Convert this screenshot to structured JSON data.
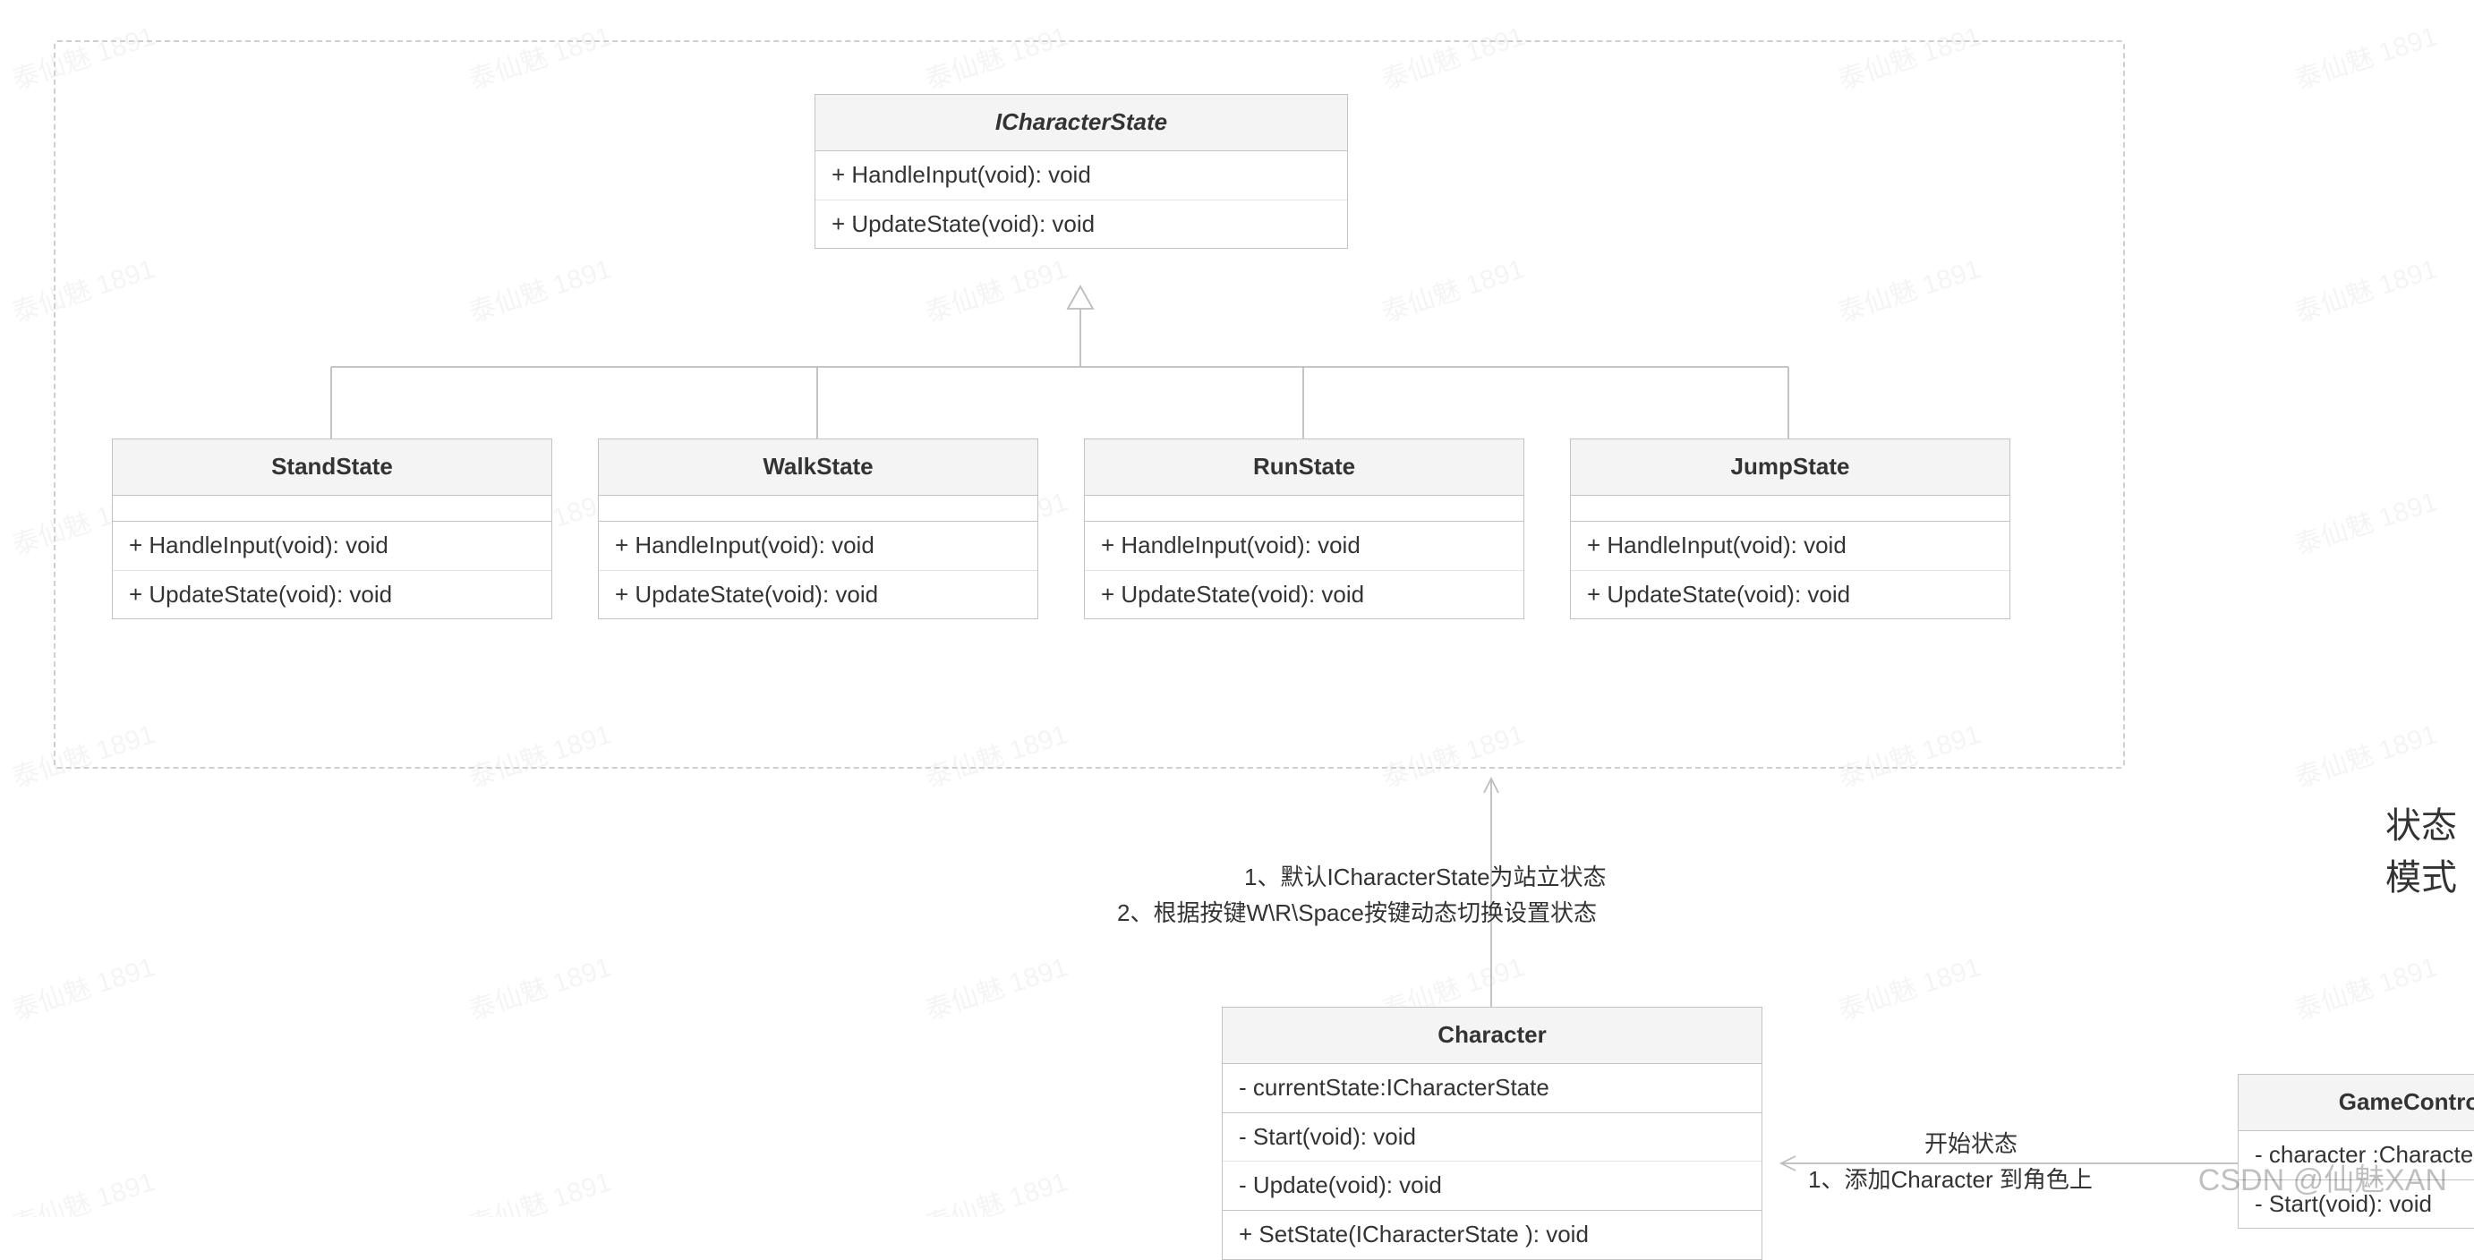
{
  "title_label": "状态模式",
  "watermark_text": "泰仙魅 1891",
  "csdn_text": "CSDN @仙魅XAN",
  "interface": {
    "name": "ICharacterState",
    "methods": [
      "+ HandleInput(void): void",
      "+ UpdateState(void): void"
    ]
  },
  "states": [
    {
      "name": "StandState",
      "methods": [
        "+ HandleInput(void): void",
        "+ UpdateState(void): void"
      ]
    },
    {
      "name": "WalkState",
      "methods": [
        "+ HandleInput(void): void",
        "+ UpdateState(void): void"
      ]
    },
    {
      "name": "RunState",
      "methods": [
        "+ HandleInput(void): void",
        "+ UpdateState(void): void"
      ]
    },
    {
      "name": "JumpState",
      "methods": [
        "+ HandleInput(void): void",
        "+ UpdateState(void): void"
      ]
    }
  ],
  "character": {
    "name": "Character",
    "attrs": [
      "- currentState:ICharacterState"
    ],
    "ops_top": [
      "- Start(void): void",
      "- Update(void): void"
    ],
    "ops_bottom": [
      "+ SetState(ICharacterState ): void"
    ]
  },
  "game_controller": {
    "name": "GameController",
    "attrs": [
      "- character :Character"
    ],
    "ops": [
      "- Start(void): void"
    ]
  },
  "note1_line1": "1、默认ICharacterState为站立状态",
  "note1_line2": "2、根据按键W\\R\\Space按键动态切换设置状态",
  "note2_line1": "开始状态",
  "note2_line2": "1、添加Character 到角色上"
}
